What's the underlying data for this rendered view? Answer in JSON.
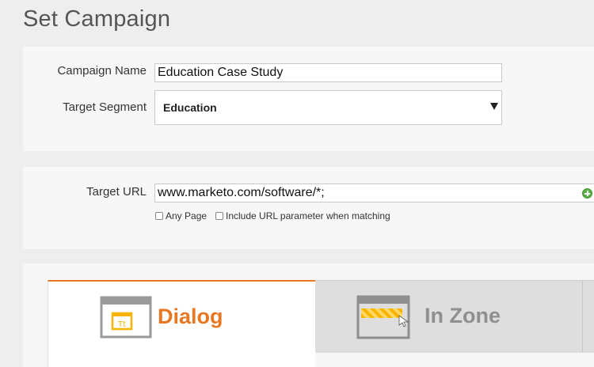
{
  "page": {
    "title": "Set Campaign"
  },
  "campaign": {
    "name_label": "Campaign Name",
    "name_value": "Education Case Study",
    "segment_label": "Target Segment",
    "segment_value": "Education"
  },
  "target": {
    "url_label": "Target URL",
    "url_value": "www.marketo.com/software/*;",
    "any_page_label": "Any Page",
    "include_param_label": "Include URL parameter when matching"
  },
  "tabs": [
    {
      "label": "Dialog",
      "icon": "dialog-window-icon",
      "icon_text": "Tt",
      "active": true
    },
    {
      "label": "In Zone",
      "icon": "in-zone-window-icon",
      "active": false
    }
  ],
  "colors": {
    "accent": "#e87722",
    "icon_yellow": "#f7b500",
    "add_green": "#5cae46",
    "inactive_tab": "#dedede",
    "inactive_text": "#8f8f8f"
  }
}
